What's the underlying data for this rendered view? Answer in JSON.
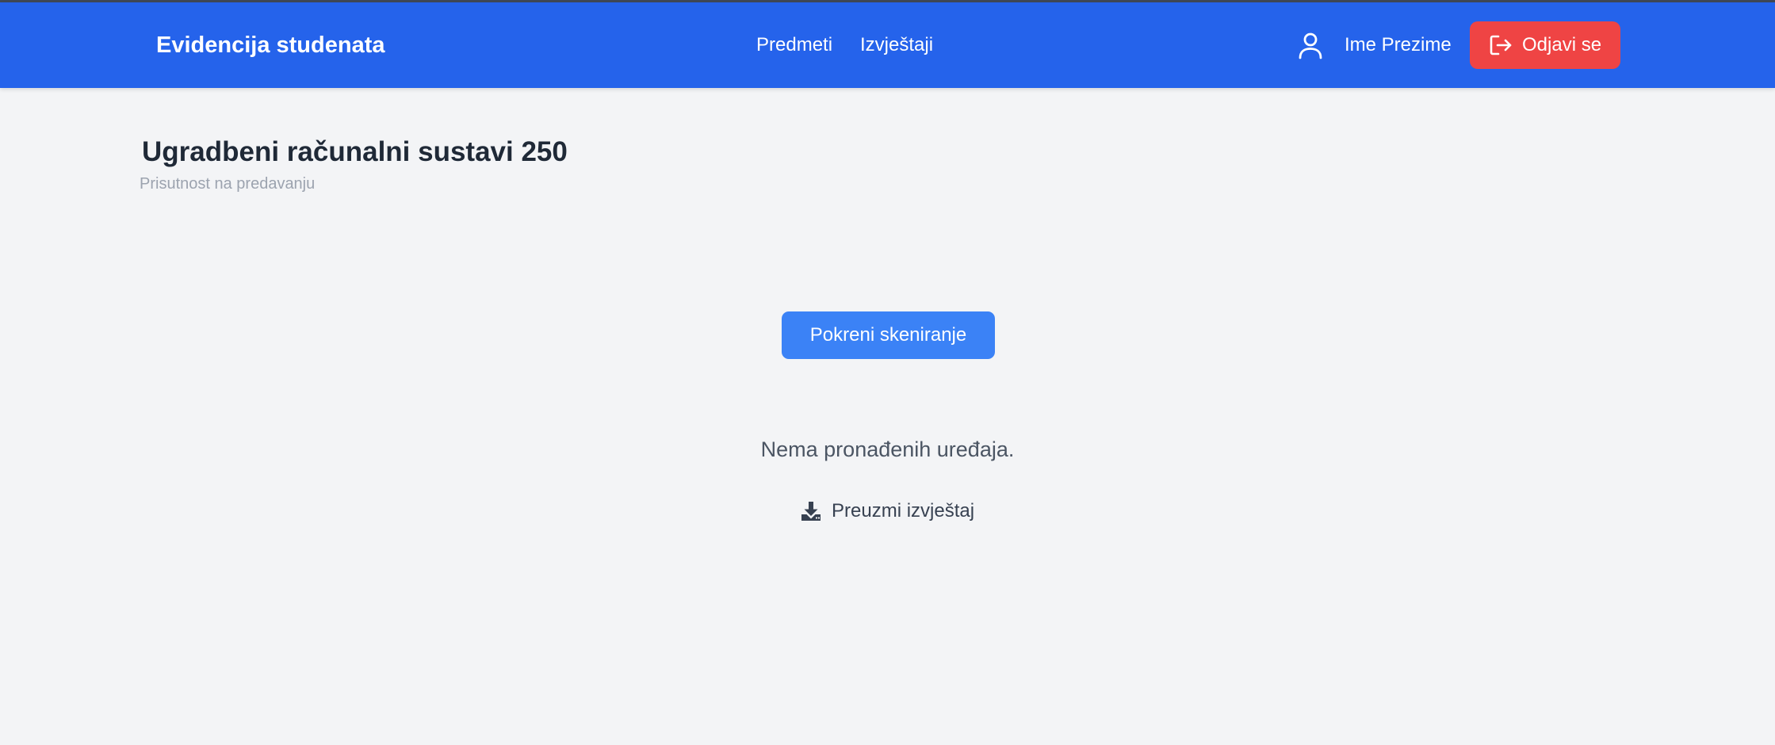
{
  "header": {
    "brand": "Evidencija studenata",
    "nav": [
      {
        "label": "Predmeti"
      },
      {
        "label": "Izvještaji"
      }
    ],
    "user_icon": "user-icon",
    "user_name": "Ime Prezime",
    "logout": {
      "icon": "logout-icon",
      "label": "Odjavi se"
    }
  },
  "page": {
    "title": "Ugradbeni računalni sustavi 250",
    "subtitle": "Prisutnost na predavanju"
  },
  "actions": {
    "scan_label": "Pokreni skeniranje",
    "empty_message": "Nema pronađenih uređaja.",
    "download": {
      "icon": "download-icon",
      "label": "Preuzmi izvještaj"
    }
  },
  "colors": {
    "navbar": "#2563eb",
    "logout_button": "#ef4444",
    "primary_button": "#3b82f6",
    "background": "#f3f4f6",
    "title_text": "#1f2937",
    "subtitle_text": "#9ca3af"
  }
}
